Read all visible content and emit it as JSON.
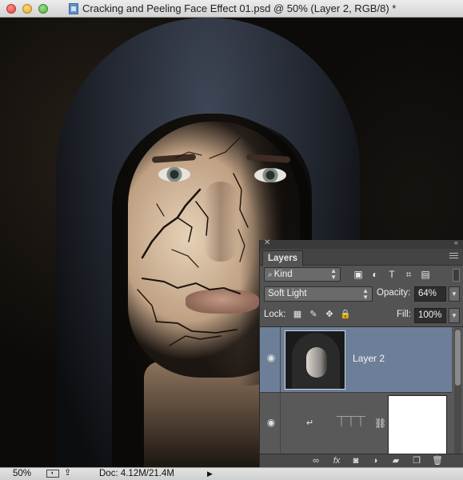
{
  "window": {
    "title": "Cracking and Peeling Face Effect 01.psd @ 50% (Layer 2, RGB/8) *",
    "icons": [
      "close-button",
      "minimize-button",
      "maximize-button",
      "psd-document-icon"
    ]
  },
  "layers_panel": {
    "tab_label": "Layers",
    "filter": {
      "kind_label": "Kind",
      "icons": [
        "image-filter-icon",
        "adjustment-filter-icon",
        "type-filter-icon",
        "shape-filter-icon",
        "smart-object-filter-icon"
      ],
      "type_glyph": "T"
    },
    "blend_mode": "Soft Light",
    "opacity_label": "Opacity:",
    "opacity_value": "64%",
    "lock_label": "Lock:",
    "fill_label": "Fill:",
    "fill_value": "100%",
    "layers": [
      {
        "name": "Layer 2",
        "selected": true,
        "visible": true
      },
      {
        "name": "",
        "selected": false,
        "visible": true,
        "type": "levels-adjustment"
      }
    ],
    "footer_icons": [
      "link-layers-icon",
      "fx-icon",
      "layer-mask-icon",
      "adjustment-layer-icon",
      "group-folder-icon",
      "new-layer-icon",
      "trash-icon"
    ],
    "fx_label": "fx"
  },
  "status_bar": {
    "zoom": "50%",
    "doc_info": "Doc: 4.12M/21.4M"
  },
  "colors": {
    "panel_bg": "#535353",
    "selected_layer": "#6d7f98",
    "titlebar": "#d3d3d3"
  }
}
